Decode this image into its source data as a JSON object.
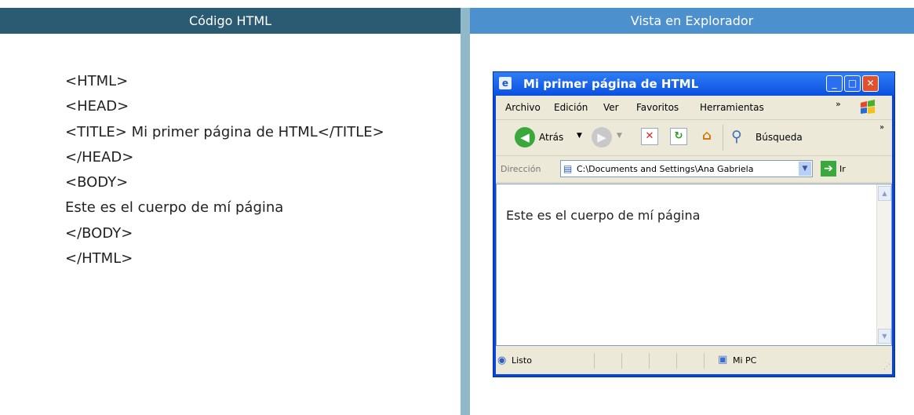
{
  "left_header": "Código HTML",
  "right_header": "Vista en Explorador",
  "code_lines": [
    "<HTML>",
    "<HEAD>",
    "<TITLE> Mi primer página de HTML</TITLE>",
    "</HEAD>",
    "<BODY>",
    "Este es el cuerpo de mí página",
    "</BODY>",
    "</HTML>"
  ],
  "browser": {
    "title": "Mi primer página de HTML",
    "menu": [
      "Archivo",
      "Edición",
      "Ver",
      "Favoritos",
      "Herramientas"
    ],
    "toolbar": {
      "back": "Atrás",
      "search": "Búsqueda"
    },
    "address": {
      "label": "Dirección",
      "value": "C:\\Documents and Settings\\Ana Gabriela",
      "go": "Ir"
    },
    "body_text": "Este es el cuerpo de mí página",
    "status": {
      "text": "Listo",
      "zone": "Mi PC"
    }
  },
  "colors": {
    "left_header_bg": "#2b5b73",
    "right_header_bg": "#4c90cd",
    "divider": "#8fb8c8",
    "xp_title_blue": "#0a4fe0"
  },
  "icons": [
    "ie-logo-icon",
    "back-arrow-icon",
    "forward-arrow-icon",
    "stop-icon",
    "refresh-icon",
    "home-icon",
    "search-icon",
    "page-icon",
    "go-arrow-icon",
    "windows-flag-icon",
    "my-computer-icon"
  ]
}
